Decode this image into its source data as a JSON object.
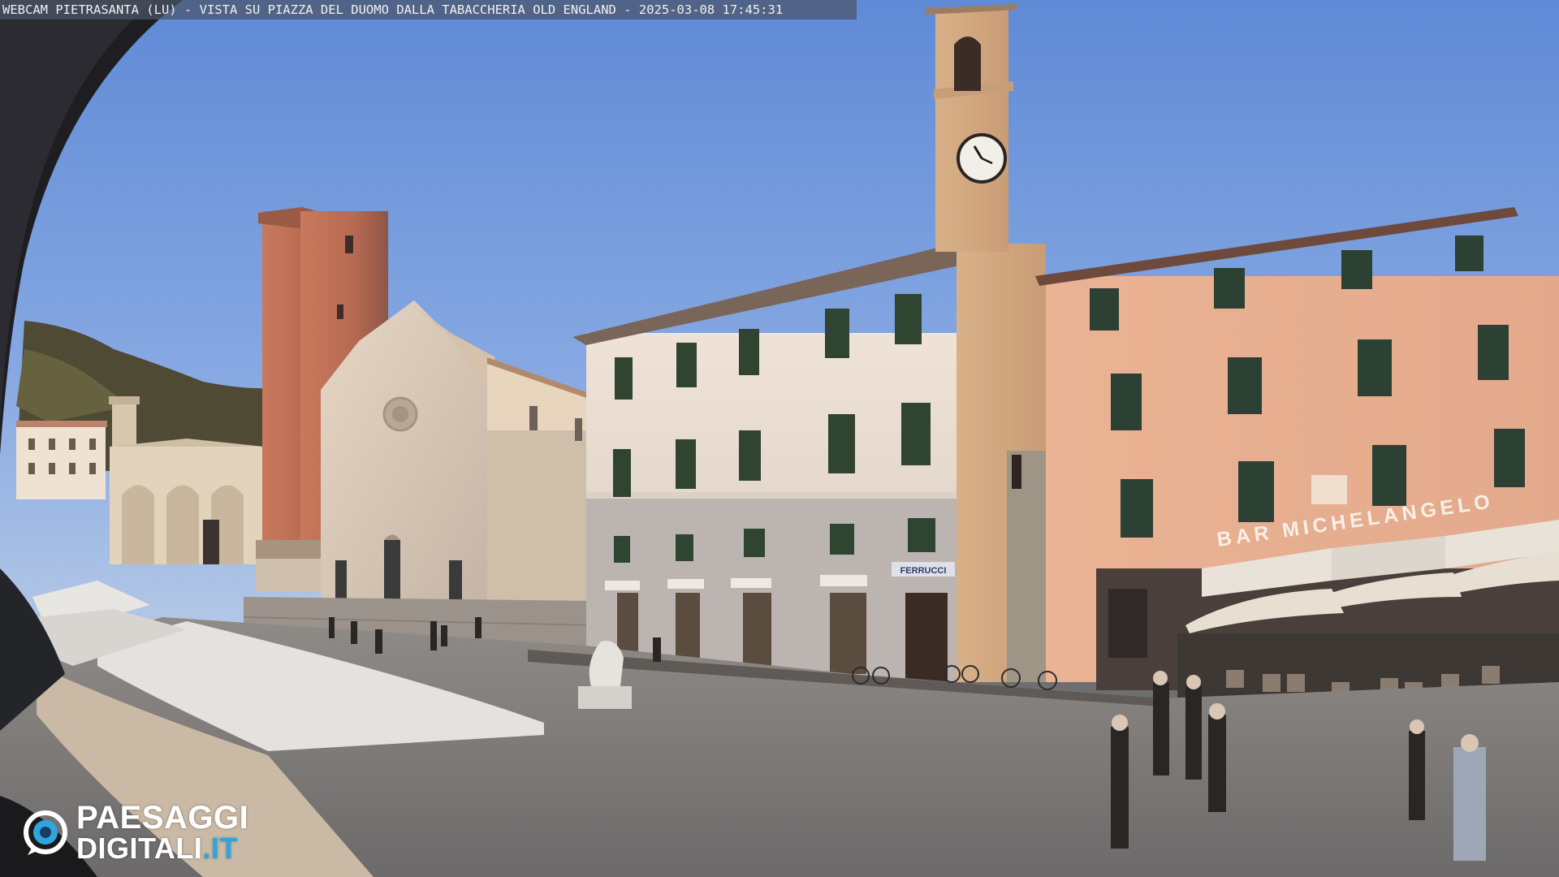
{
  "overlay": {
    "caption": "WEBCAM PIETRASANTA (LU) - VISTA SU PIAZZA DEL DUOMO DALLA TABACCHERIA OLD ENGLAND - 2025-03-08 17:45:31"
  },
  "brand": {
    "line1": "PAESAGGI",
    "line2_main": "DIGITALI",
    "line2_suffix": ".IT",
    "accent_color": "#2fa5e0"
  },
  "scene": {
    "bar_sign": "BAR MICHELANGELO",
    "shop_sign": "FERRUCCI"
  }
}
